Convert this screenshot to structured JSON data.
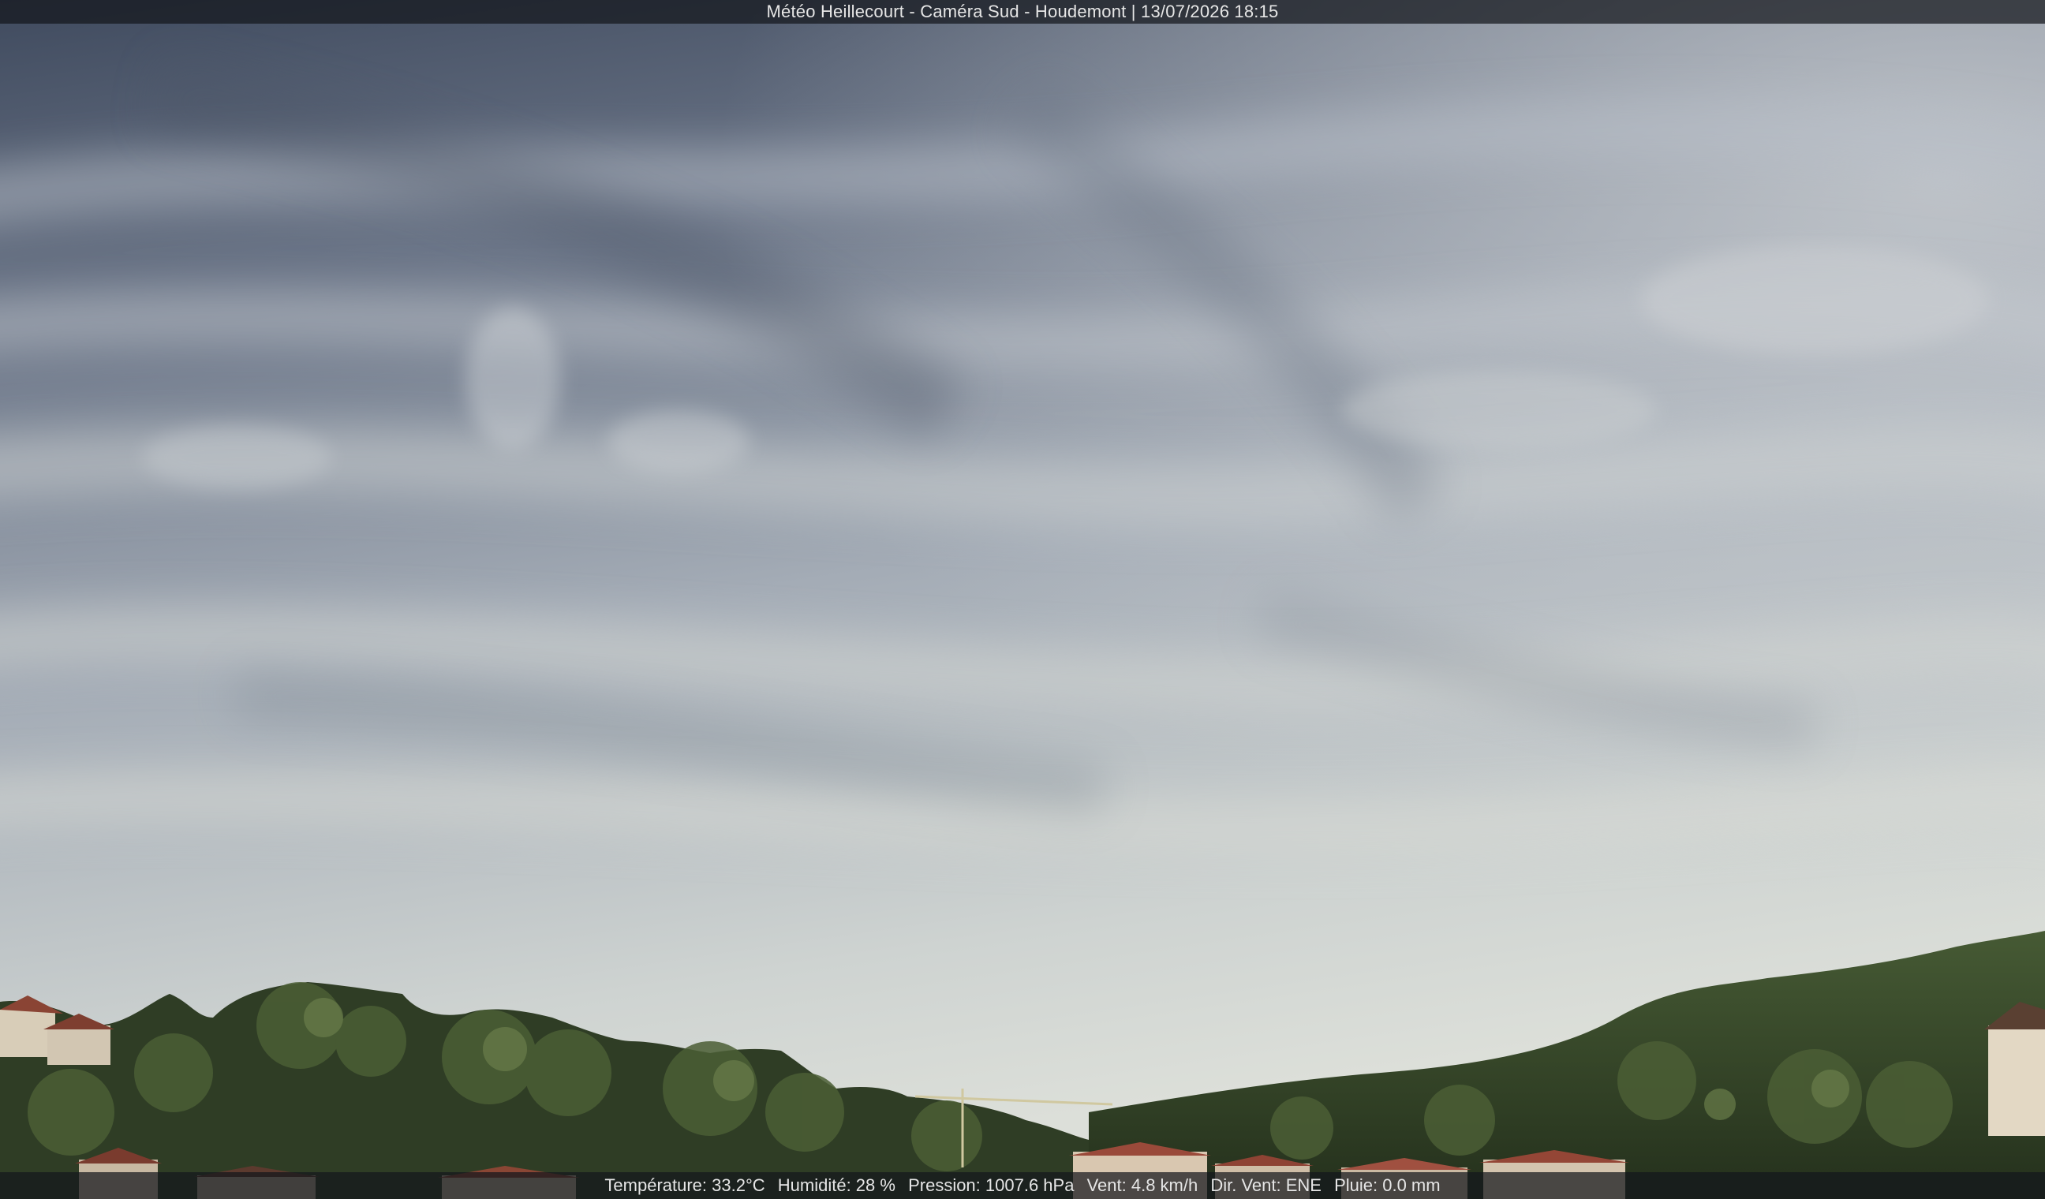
{
  "header": {
    "station": "Météo Heillecourt",
    "separator1": " - ",
    "camera": "Caméra Sud",
    "separator2": " - ",
    "location": "Houdemont",
    "separator3": " | ",
    "datetime": "13/07/2026 18:15"
  },
  "weather": {
    "temperature": "Température: 33.2°C",
    "humidity": "Humidité: 28 %",
    "pressure": "Pression: 1007.6 hPa",
    "wind": "Vent: 4.8 km/h",
    "wind_direction": "Dir. Vent: ENE",
    "rain": "Pluie: 0.0 mm"
  },
  "colors": {
    "sky_top": "#4a5466",
    "sky_mid": "#9aa3ae",
    "sky_horizon": "#d6dad6",
    "foliage_dark": "#2c3a22",
    "foliage_light": "#5b6e3e",
    "roof": "#9a4a3a",
    "overlay_text": "#e6e6e6"
  }
}
